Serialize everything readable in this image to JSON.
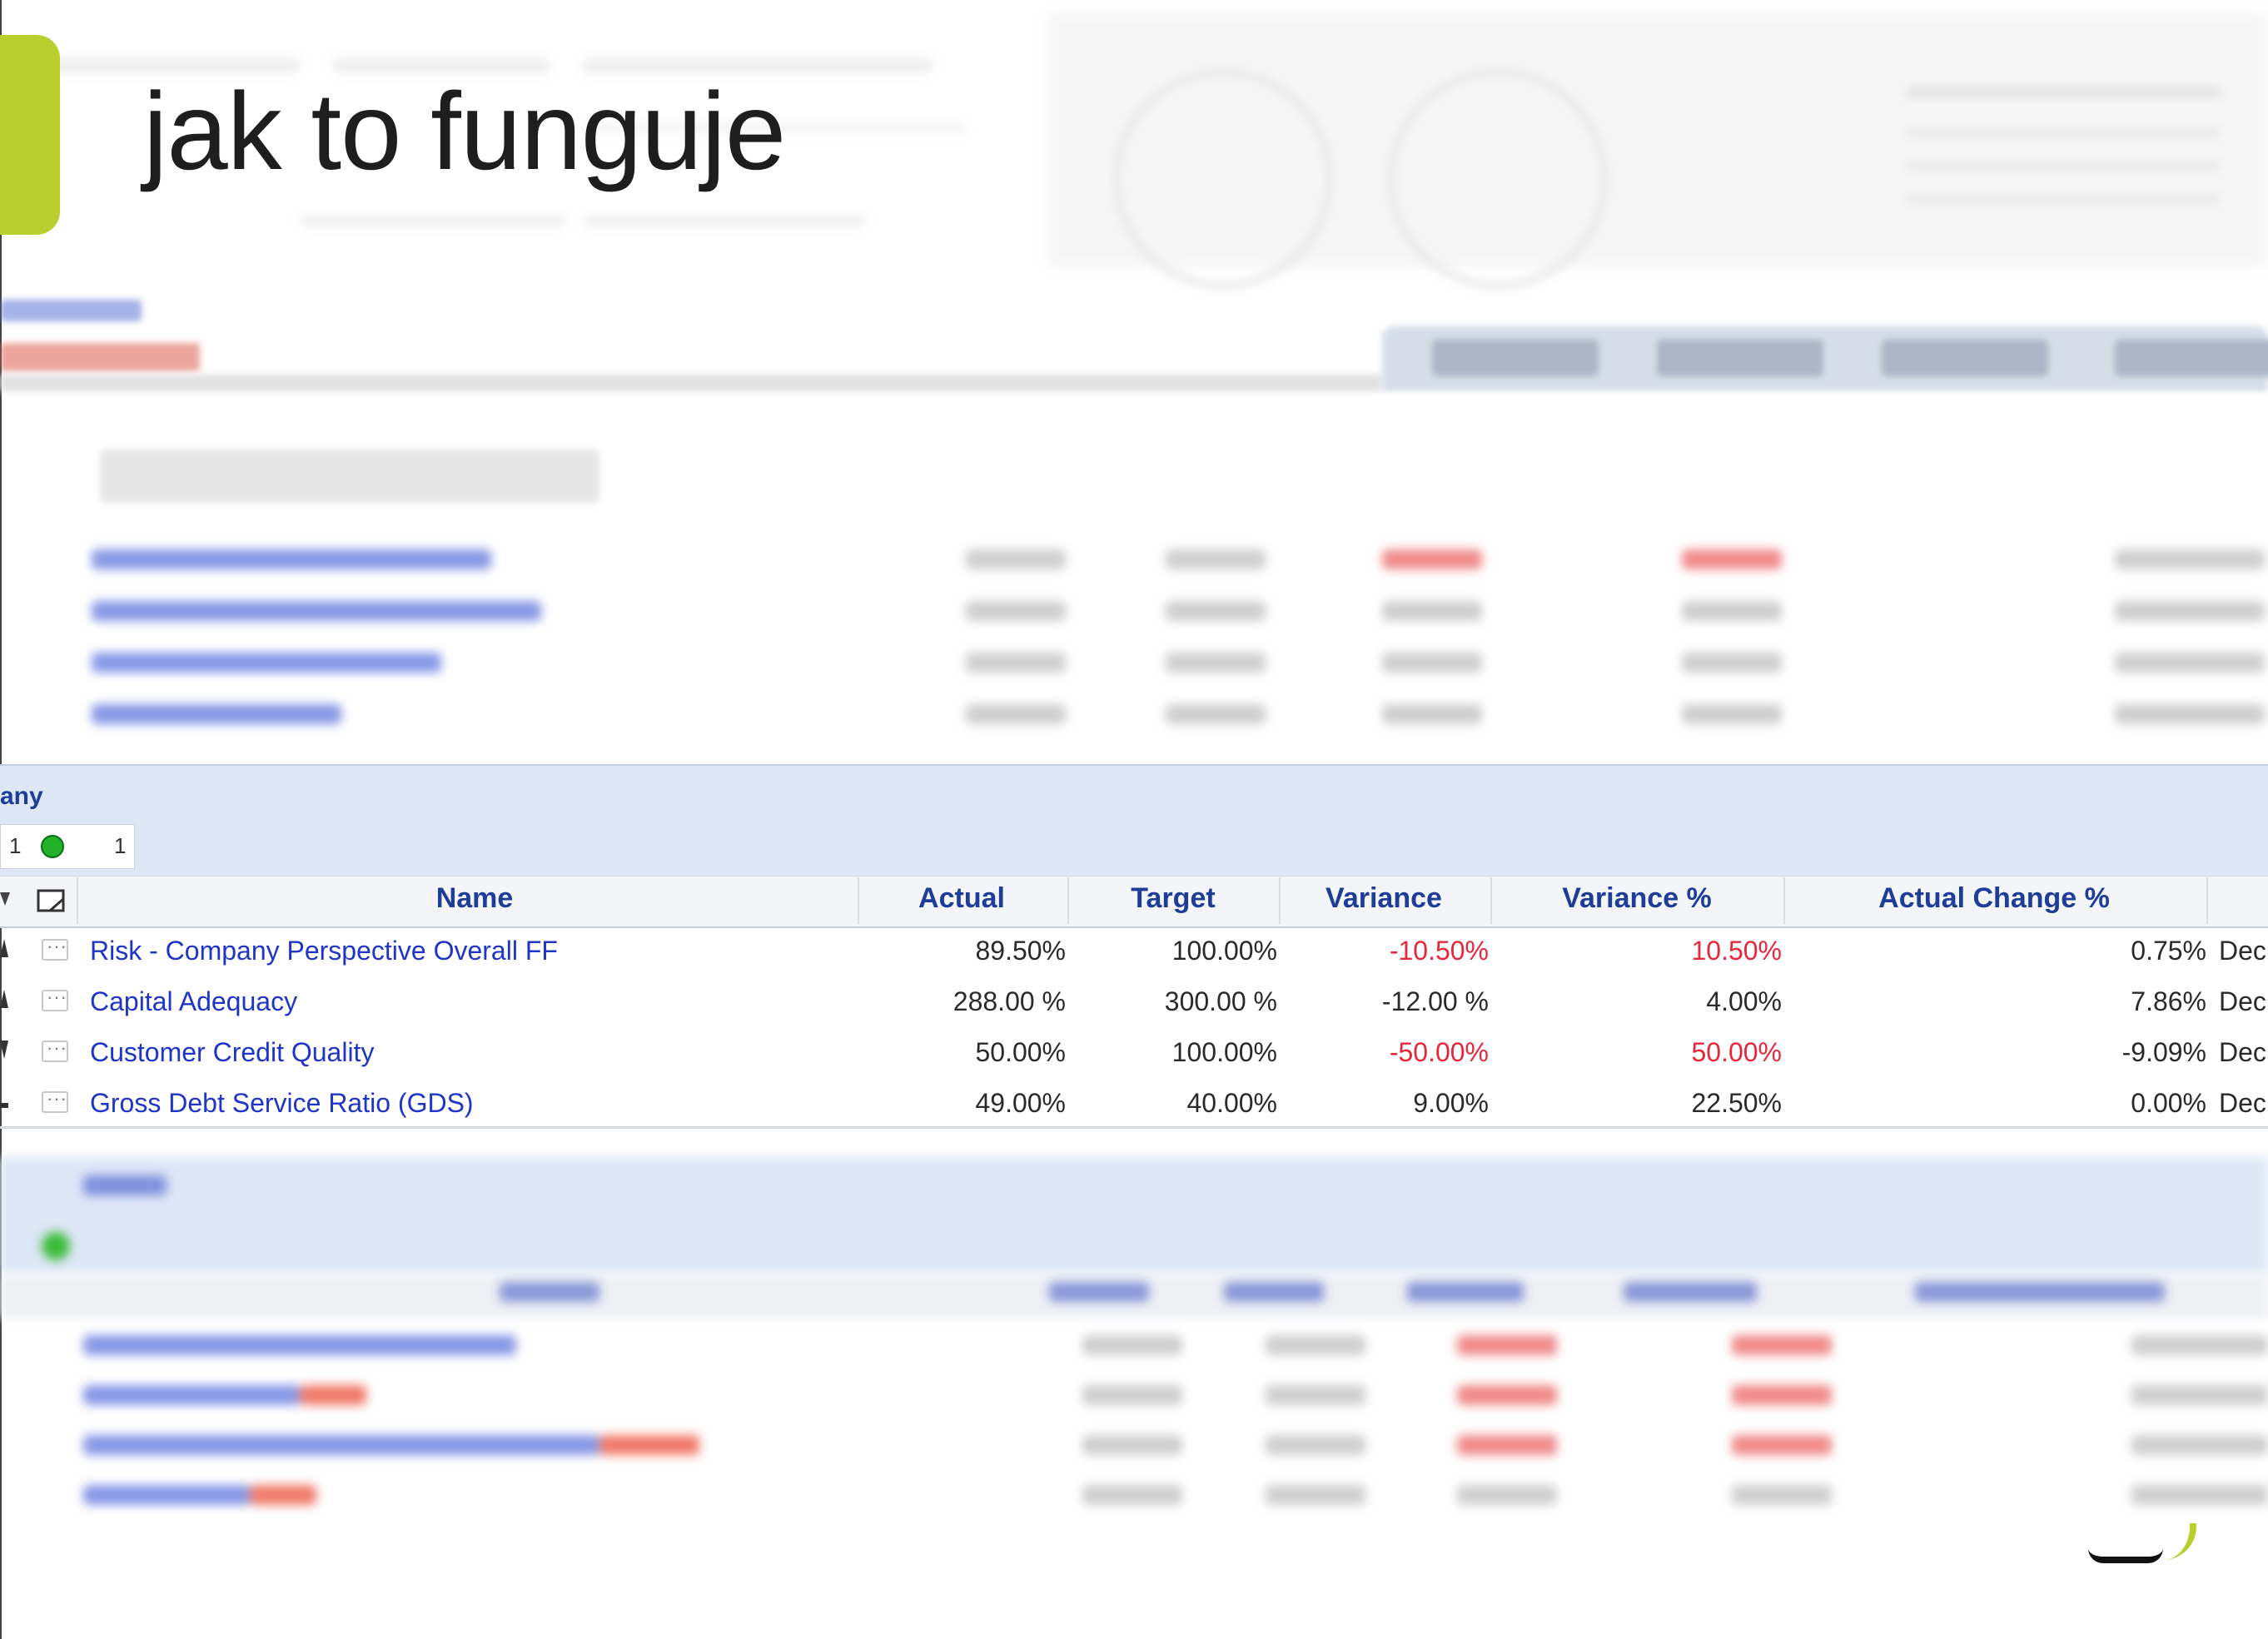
{
  "slide": {
    "title": "jak to funguje"
  },
  "section": {
    "title_fragment": "any",
    "status_count_left": "1",
    "status_count_right": "1",
    "status_color": "#22b22a"
  },
  "table": {
    "columns": {
      "name": "Name",
      "actual": "Actual",
      "target": "Target",
      "variance": "Variance",
      "variance_pct": "Variance %",
      "actual_change_pct": "Actual Change %"
    },
    "rows": [
      {
        "name": "Risk - Company Perspective Overall FF",
        "actual": "89.50%",
        "target": "100.00%",
        "variance": "-10.50%",
        "variance_pct": "10.50%",
        "actual_change_pct": "0.75%",
        "date": "Dec",
        "negative": true,
        "trend": "up"
      },
      {
        "name": "Capital Adequacy",
        "actual": "288.00 %",
        "target": "300.00 %",
        "variance": "-12.00 %",
        "variance_pct": "4.00%",
        "actual_change_pct": "7.86%",
        "date": "Dec",
        "negative": false,
        "trend": "up"
      },
      {
        "name": "Customer Credit Quality",
        "actual": "50.00%",
        "target": "100.00%",
        "variance": "-50.00%",
        "variance_pct": "50.00%",
        "actual_change_pct": "-9.09%",
        "date": "Dec",
        "negative": true,
        "trend": "down"
      },
      {
        "name": "Gross Debt Service Ratio (GDS)",
        "actual": "49.00%",
        "target": "40.00%",
        "variance": "9.00%",
        "variance_pct": "22.50%",
        "actual_change_pct": "0.00%",
        "date": "Dec",
        "negative": false,
        "trend": "flat"
      }
    ]
  },
  "colors": {
    "accent": "#b9cf2e",
    "link": "#1f35c7",
    "header_text": "#1d3d99",
    "negative": "#e4283c",
    "section_band": "#dde7f6"
  },
  "icons": {
    "row_action": "ellipsis-icon",
    "header_note": "note-icon",
    "trend_up": "trend-up-icon",
    "trend_down": "trend-down-icon",
    "trend_flat": "trend-flat-icon"
  }
}
